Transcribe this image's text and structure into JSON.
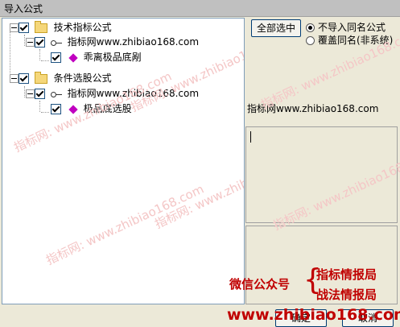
{
  "window": {
    "title": "导入公式"
  },
  "tree": {
    "root1": {
      "label": "技术指标公式",
      "child": {
        "label": "指标网www.zhibiao168.com",
        "leaf": "乖离极品底剐"
      }
    },
    "root2": {
      "label": "条件选股公式",
      "child": {
        "label": "指标网www.zhibiao168.com",
        "leaf": "极品底选股"
      }
    }
  },
  "controls": {
    "select_all": "全部选中",
    "radio1": "不导入同名公式",
    "radio2": "覆盖同名(非系统)",
    "radio_selected": "不导入同名公式"
  },
  "info": {
    "site": "指标网www.zhibiao168.com"
  },
  "ad": {
    "left": "微信公众号",
    "right1": "指标情报局",
    "right2": "战法情报局",
    "site": "www.zhibiao168.com",
    "brace": "{"
  },
  "buttons": {
    "ok": "确定",
    "cancel": "取消"
  },
  "watermark": "指标网: www.zhibiao168.com"
}
